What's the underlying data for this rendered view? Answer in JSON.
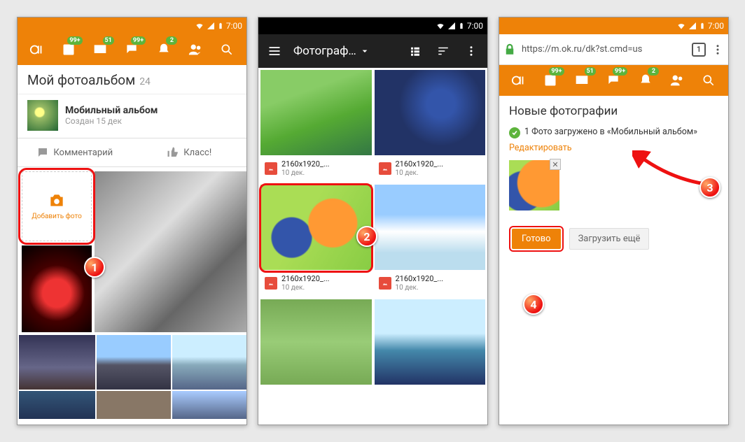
{
  "status": {
    "time": "7:00"
  },
  "toolbar": {
    "badge_feed": "99+",
    "badge_msg": "51",
    "badge_disc": "99+",
    "badge_notif": "2"
  },
  "p1": {
    "title": "Мой фотоальбом",
    "count": "24",
    "album_name": "Мобильный альбом",
    "album_date": "Создан 15 дек",
    "comment_label": "Комментарий",
    "like_label": "Класс!",
    "add_photo_label": "Добавить фото"
  },
  "p2": {
    "title": "Фотограф…",
    "items": [
      {
        "name": "2160x1920_...",
        "date": "10 дек."
      },
      {
        "name": "2160x1920_...",
        "date": "10 дек."
      },
      {
        "name": "2160x1920_...",
        "date": "10 дек."
      },
      {
        "name": "2160x1920_...",
        "date": "10 дек."
      }
    ]
  },
  "p3": {
    "url": "https://m.ok.ru/dk?st.cmd=us",
    "tab_count": "1",
    "heading": "Новые фотографии",
    "success_msg": "1 Фото загружено в «Мобильный альбом»",
    "edit_label": "Редактировать",
    "done_label": "Готово",
    "more_label": "Загрузить ещё"
  },
  "steps": {
    "s1": "1",
    "s2": "2",
    "s3": "3",
    "s4": "4"
  }
}
